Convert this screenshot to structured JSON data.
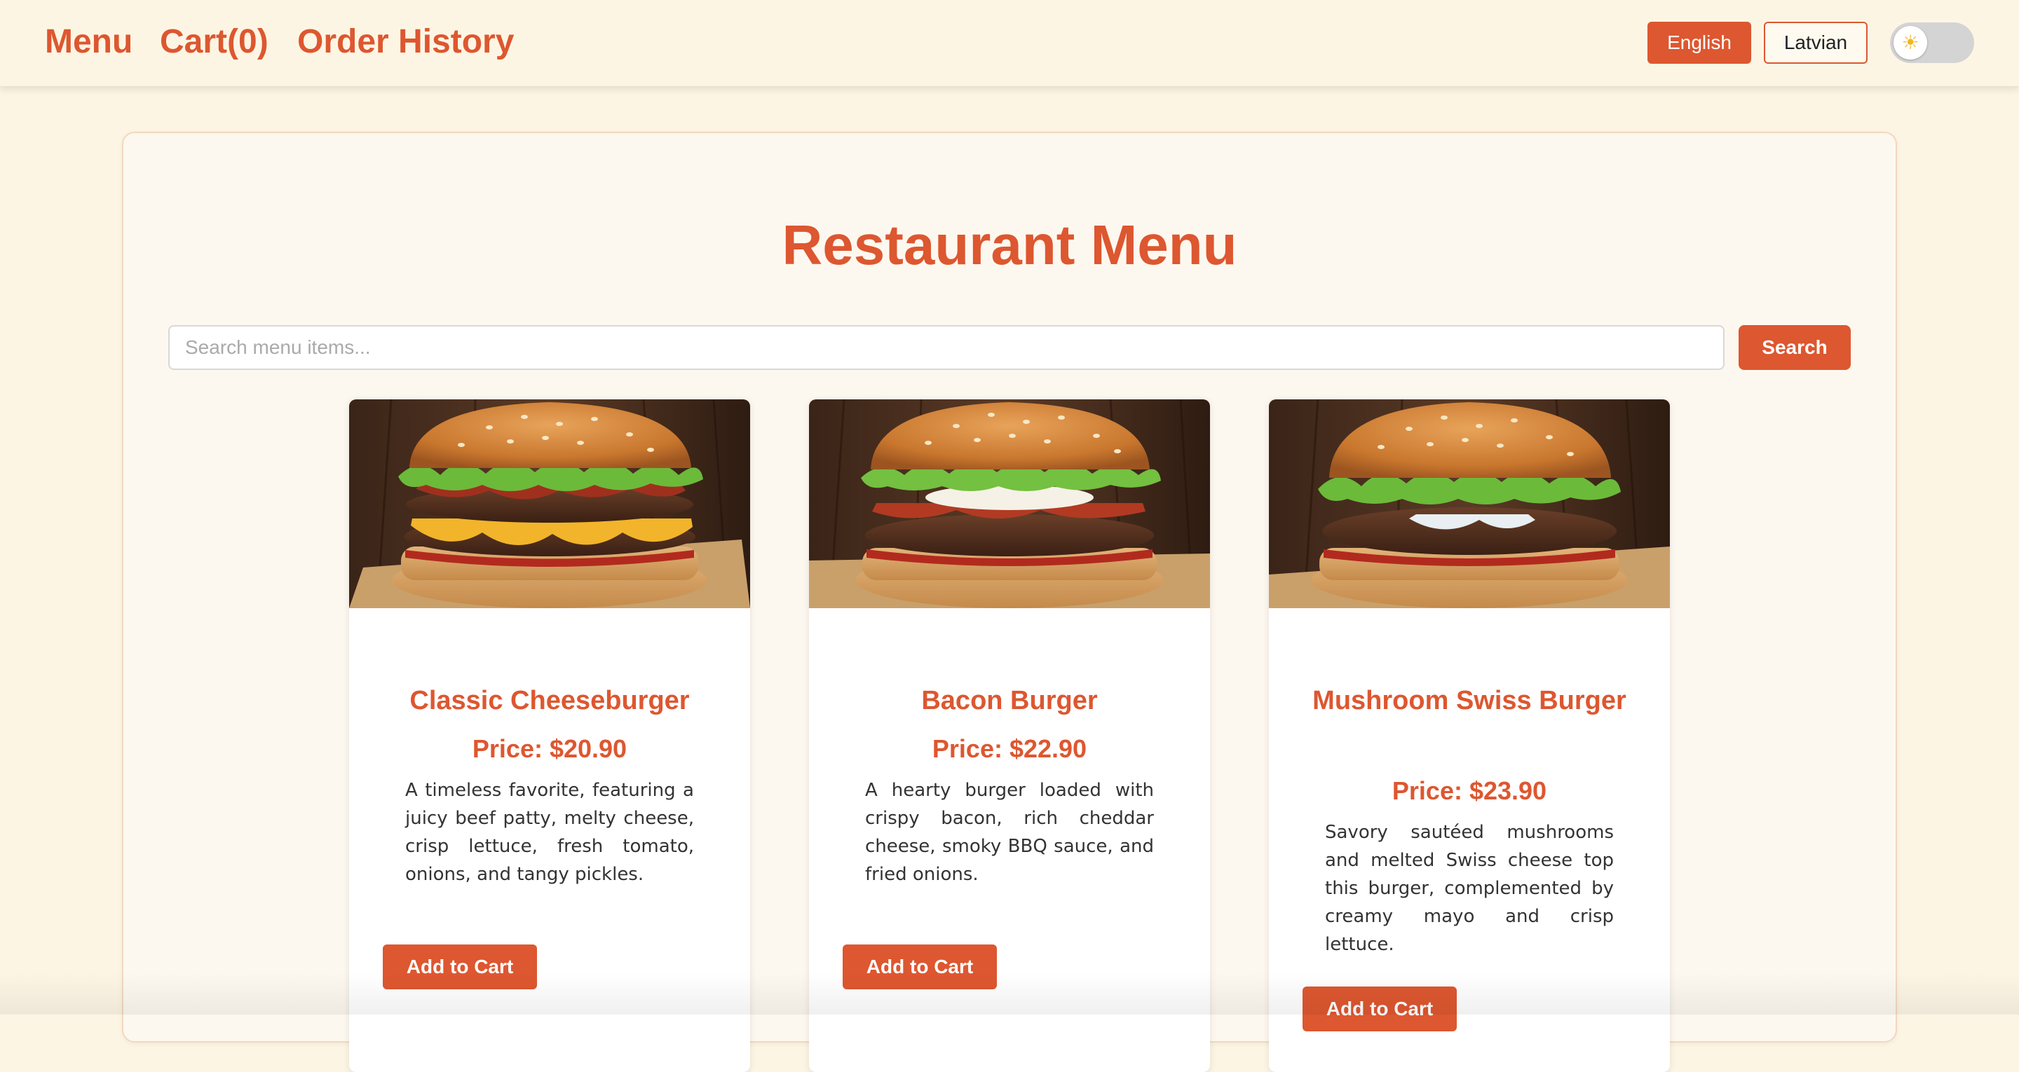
{
  "nav": {
    "menu_label": "Menu",
    "cart_label": "Cart(0)",
    "history_label": "Order History"
  },
  "language": {
    "english_label": "English",
    "latvian_label": "Latvian",
    "selected": "English"
  },
  "theme_toggle": {
    "icon": "sun-icon",
    "state": "light"
  },
  "page": {
    "title": "Restaurant Menu"
  },
  "search": {
    "placeholder": "Search menu items...",
    "value": "",
    "button_label": "Search"
  },
  "products": [
    {
      "name": "Classic Cheeseburger",
      "price": "Price: $20.90",
      "description": "A timeless favorite, featuring a juicy beef patty, melty cheese, crisp lettuce, fresh tomato, onions, and tangy pickles.",
      "button_label": "Add to Cart"
    },
    {
      "name": "Bacon Burger",
      "price": "Price: $22.90",
      "description": "A hearty burger loaded with crispy bacon, rich cheddar cheese, smoky BBQ sauce, and fried onions.",
      "button_label": "Add to Cart"
    },
    {
      "name": "Mushroom Swiss Burger",
      "price": "Price: $23.90",
      "description": "Savory sautéed mushrooms and melted Swiss cheese top this burger, complemented by creamy mayo and crisp lettuce.",
      "button_label": "Add to Cart"
    }
  ],
  "colors": {
    "accent": "#dd5730",
    "page_background": "#fdf5e4",
    "card_background": "#fdf8ef"
  }
}
